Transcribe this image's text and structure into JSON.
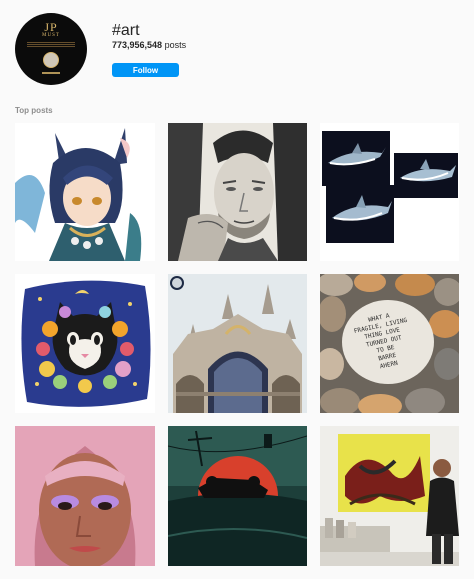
{
  "profile": {
    "avatar_logo_text": "JP",
    "avatar_logo_sub": "MUST"
  },
  "header": {
    "hashtag": "#art",
    "post_count": "773,956,548",
    "post_count_suffix": " posts",
    "follow_label": "Follow"
  },
  "top_posts": {
    "title": "Top posts",
    "posts": [
      {
        "subject": "anime character with cat ears"
      },
      {
        "subject": "pencil portrait of a man"
      },
      {
        "subject": "shark paintings"
      },
      {
        "subject": "cat with flower wreath illustration"
      },
      {
        "subject": "gothic cathedral facade"
      },
      {
        "subject": "painted stone",
        "stone_text": "WHAT A\nFRAGILE, LIVING\nTHING LOVE\nTURNED OUT\nTO BE\nBARRE\nAHERN"
      },
      {
        "subject": "portrait with purple eyeshadow"
      },
      {
        "subject": "red sunset with floating car"
      },
      {
        "subject": "artist next to abstract painting"
      }
    ]
  },
  "colors": {
    "accent": "#0095f6",
    "background": "#fafafa",
    "muted": "#8e8e8e"
  }
}
